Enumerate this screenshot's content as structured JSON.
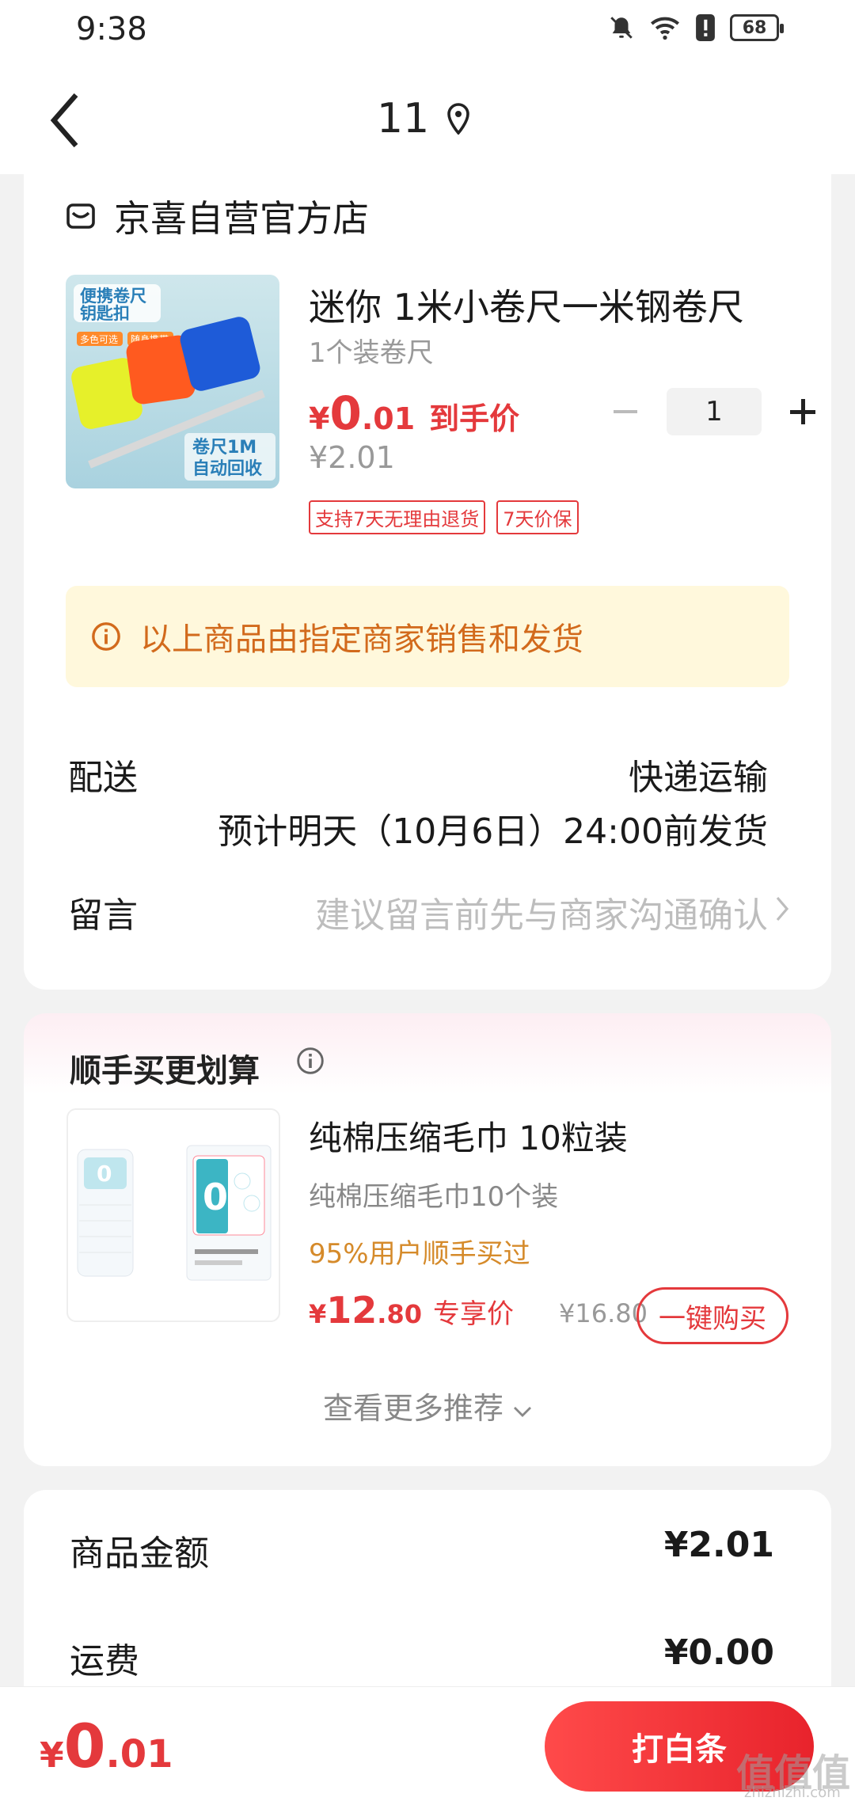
{
  "status": {
    "time": "9:38",
    "battery": "68"
  },
  "nav": {
    "title": "11"
  },
  "shop": {
    "name": "京喜自营官方店"
  },
  "product": {
    "title": "迷你 1米小卷尺一米钢卷尺",
    "spec": "1个装卷尺",
    "price_yen": "¥",
    "price_int": "0",
    "price_dec": ".01",
    "price_tag": "到手价",
    "orig_price": "¥2.01",
    "quantity": "1",
    "tags": [
      "支持7天无理由退货",
      "7天价保"
    ],
    "image": {
      "badge_line1": "便携卷尺",
      "badge_line2": "钥匙扣",
      "chip1": "多色可选",
      "chip2": "随身携带",
      "bottom_line1": "卷尺1M",
      "bottom_line2": "自动回收"
    }
  },
  "notice": {
    "text": "以上商品由指定商家销售和发货"
  },
  "delivery": {
    "label": "配送",
    "method": "快递运输",
    "eta": "预计明天（10月6日）24:00前发货"
  },
  "message": {
    "label": "留言",
    "placeholder": "建议留言前先与商家沟通确认"
  },
  "recommend": {
    "title": "顺手买更划算",
    "item_name": "纯棉压缩毛巾 10粒装",
    "item_spec": "纯棉压缩毛巾10个装",
    "hint": "95%用户顺手买过",
    "price_yen": "¥",
    "price_int": "12",
    "price_dec": ".80",
    "price_label": "专享价",
    "old_price": "¥16.80",
    "buy_label": "一键购买",
    "more_label": "查看更多推荐"
  },
  "summary": {
    "items_label": "商品金额",
    "items_value": "¥2.01",
    "shipping_label": "运费",
    "shipping_value": "¥0.00"
  },
  "bottom": {
    "total_yen": "¥",
    "total_int": "0",
    "total_dec": ".01",
    "pay_label": "打白条"
  },
  "watermark": {
    "main": "值值值",
    "sub": "zhizhizhi.com"
  },
  "colors": {
    "accent": "#e4393c",
    "notice_bg": "#fff8dc",
    "notice_text": "#d26a1c"
  }
}
